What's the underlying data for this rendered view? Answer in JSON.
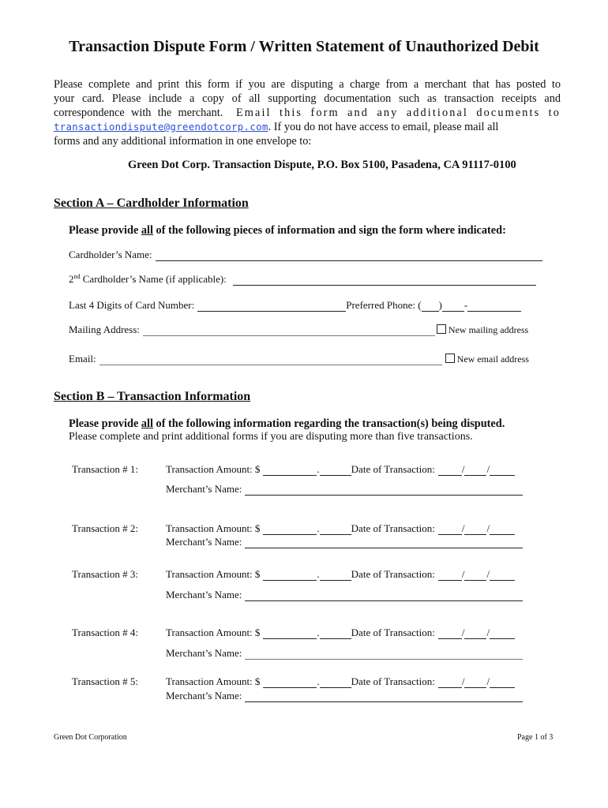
{
  "document": {
    "title": "Transaction Dispute Form / Written Statement of Unauthorized Debit",
    "intro": {
      "line1": "Please complete and print this form if you are disputing a charge from a merchant that has posted to",
      "line2": "your card.   Please include a copy of all supporting documentation such as transaction receipts and",
      "line3_a": "correspondence with the merchant.",
      "line3_b": "Email this form and any additional documents to",
      "email": "transactiondispute@greendotcorp.com",
      "line4_b": ".   If you do not have access to email, please mail all",
      "line5": "forms and any additional information in one envelope to:"
    },
    "mailing_address": "Green Dot Corp. Transaction Dispute, P.O. Box 5100, Pasadena, CA  91117-0100"
  },
  "section_a": {
    "heading": "Section A – Cardholder Information",
    "instruction_pre": "Please provide ",
    "instruction_emph": "all",
    "instruction_post": " of the following pieces of information and sign the form where indicated:",
    "fields": {
      "cardholder_name": "Cardholder’s Name:",
      "second_cardholder_prefix": "2",
      "second_cardholder_sup": "nd",
      "second_cardholder": " Cardholder’s Name (if applicable):",
      "last4": "Last 4 Digits of Card Number:",
      "phone": "Preferred Phone: (",
      "phone_mid": ")",
      "phone_dash": "-",
      "mailing_address": "Mailing Address:",
      "new_mailing_address": "New mailing  address",
      "email": "Email:",
      "new_email_address": "New email address"
    }
  },
  "section_b": {
    "heading": "Section B –  Transaction Information",
    "instruction_pre": "Please provide ",
    "instruction_emph": "all",
    "instruction_post": " of the following information regarding the transaction(s) being disputed.",
    "note": "Please complete and print additional forms if you are disputing more than five transactions.",
    "amount_label": "Transaction Amount:  $",
    "decimal": ".",
    "date_label": "Date of Transaction:",
    "date_sep": "/",
    "merchant_label": "Merchant’s Name:",
    "transactions": [
      {
        "label": "Transaction # 1:"
      },
      {
        "label": "Transaction # 2:"
      },
      {
        "label": "Transaction # 3:"
      },
      {
        "label": "Transaction # 4:"
      },
      {
        "label": "Transaction # 5:"
      }
    ]
  },
  "footer": {
    "company": "Green Dot Corporation",
    "page": "Page 1 of 3"
  }
}
